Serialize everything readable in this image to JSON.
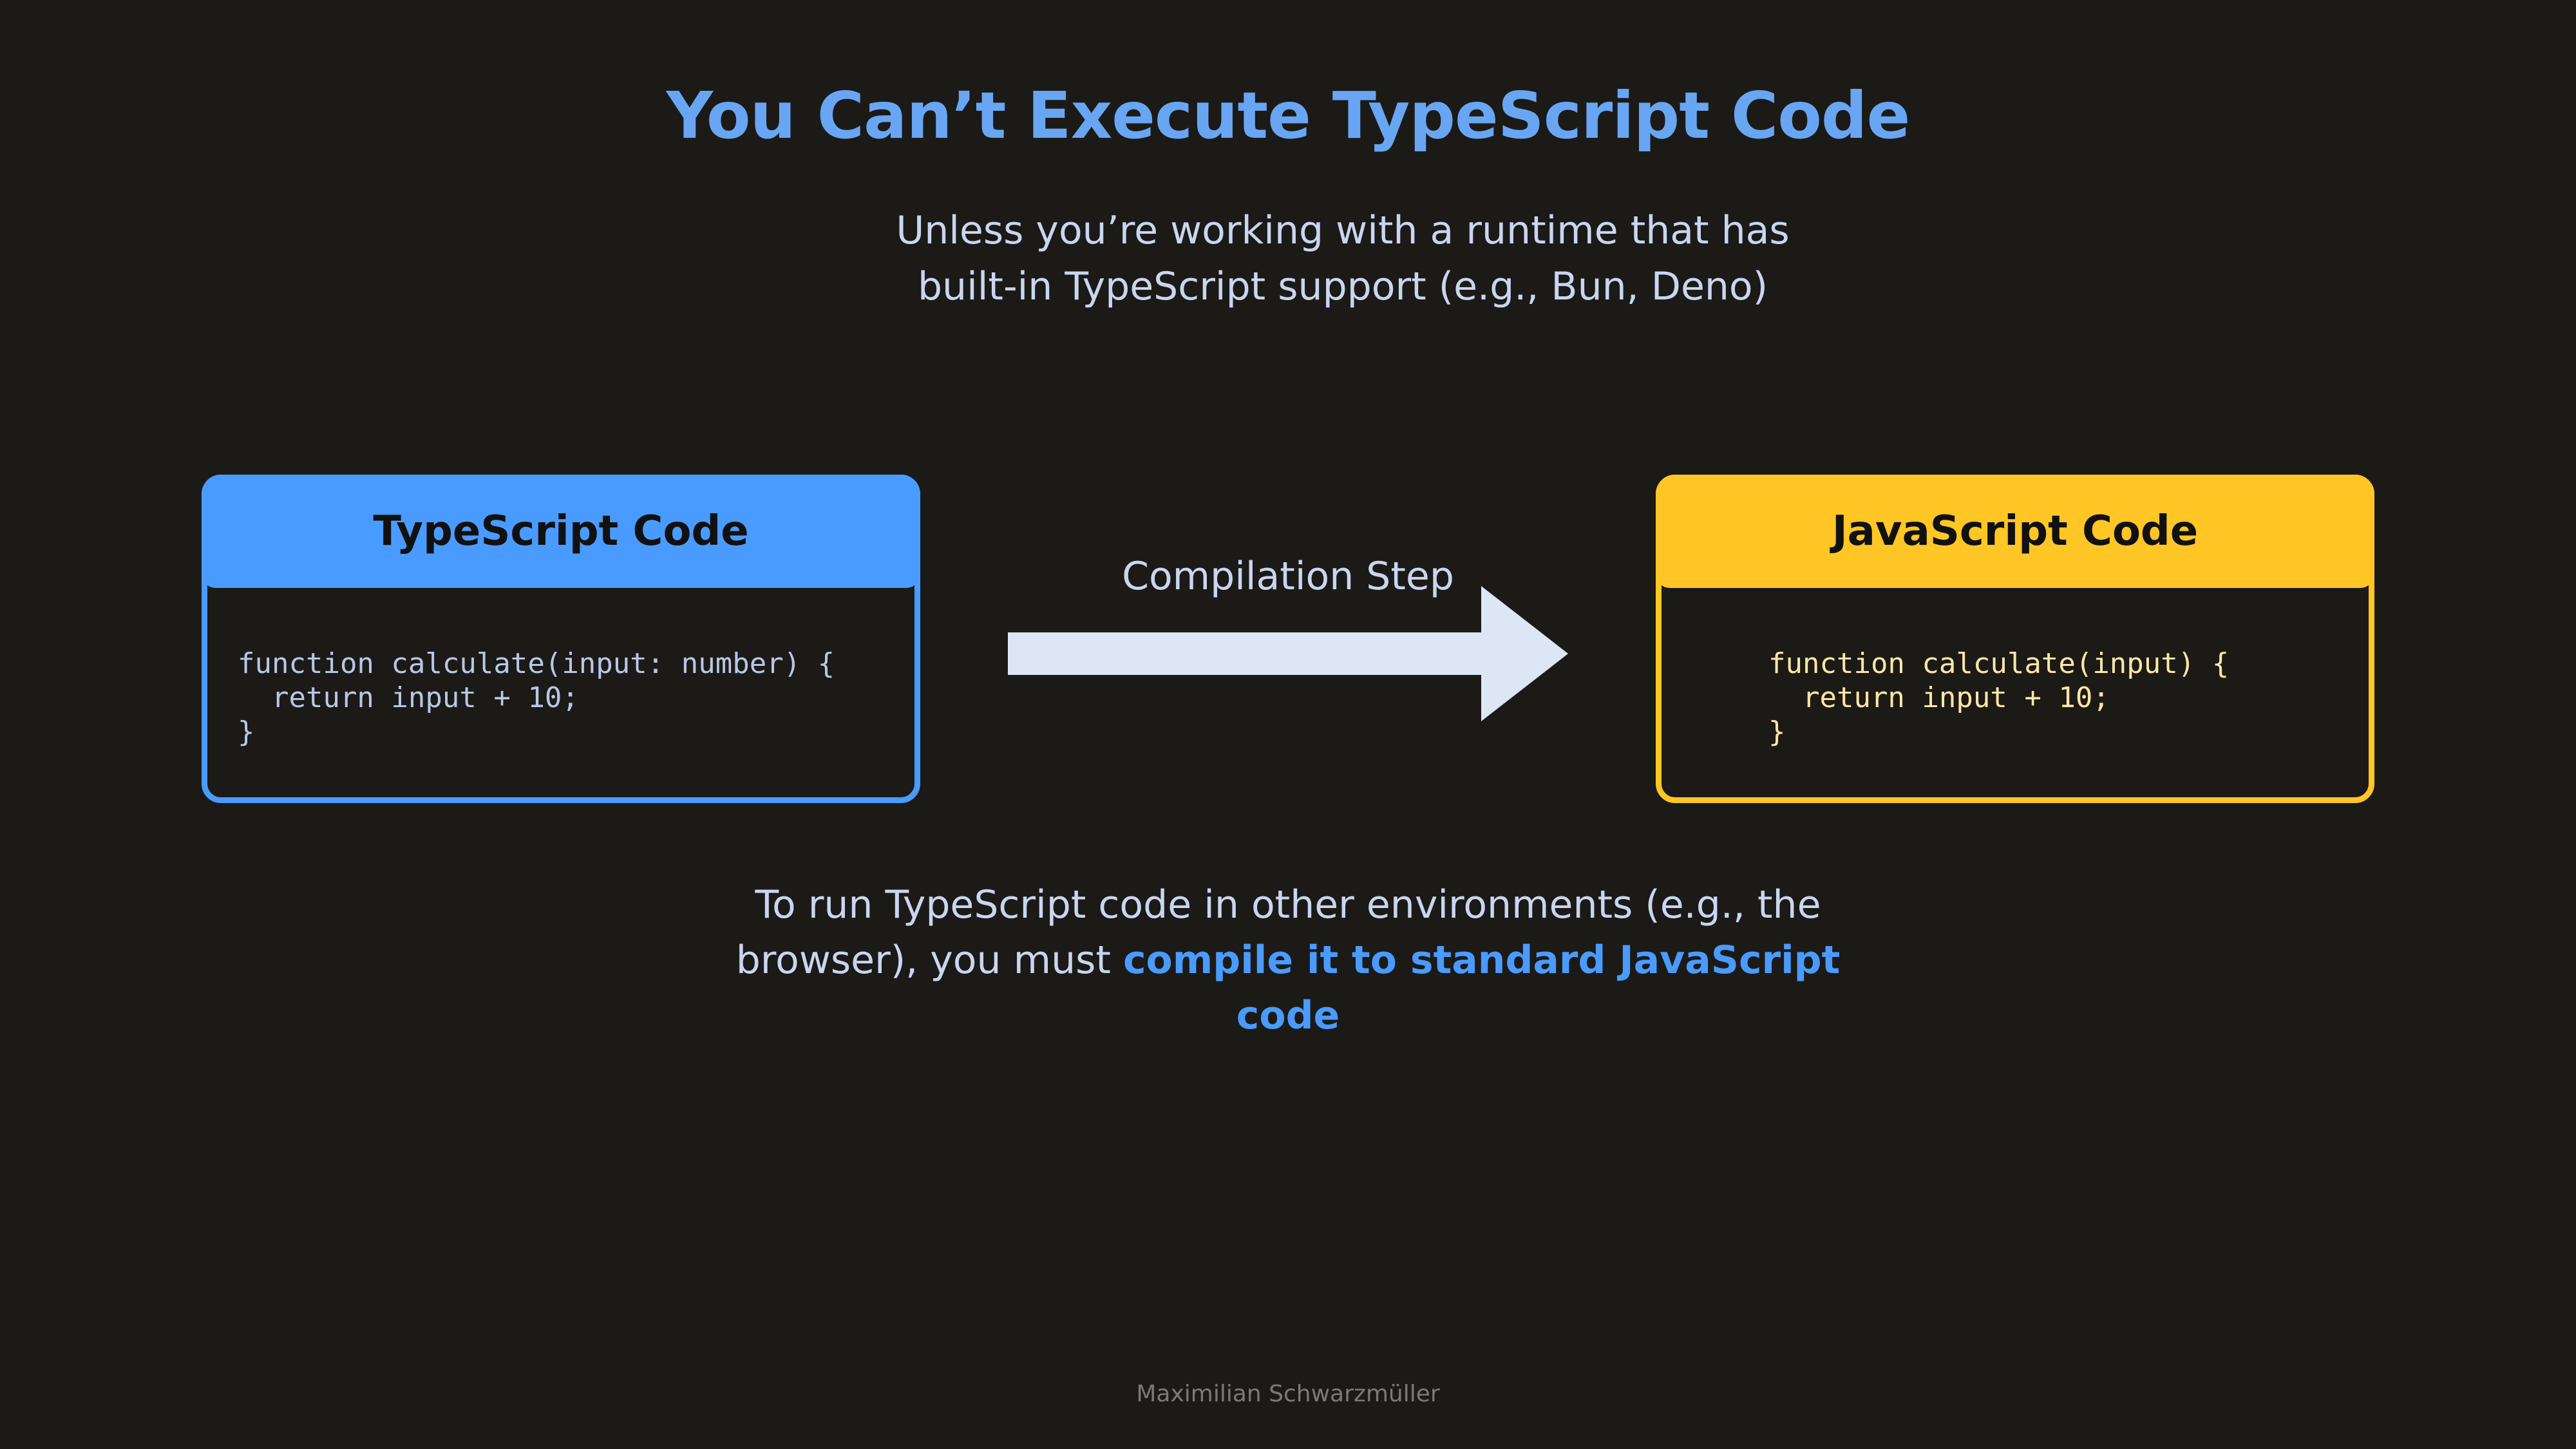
{
  "slide": {
    "title": "You Can’t Execute TypeScript Code",
    "subtitle_lines": [
      "Unless you’re working with a runtime that has",
      "built-in TypeScript support (e.g., Bun, Deno)"
    ]
  },
  "typescript_box": {
    "header": "TypeScript Code",
    "code_lines": [
      "function calculate(input: number) {",
      "  return input + 10;",
      "}"
    ],
    "accent_color": "#4a9bff"
  },
  "compilation": {
    "label": "Compilation Step",
    "arrow_color": "#dde6f4"
  },
  "javascript_box": {
    "header": "JavaScript Code",
    "code_lines": [
      "function calculate(input) {",
      "  return input + 10;",
      "}"
    ],
    "accent_color": "#ffc626"
  },
  "bottom_text": {
    "line1": "To run TypeScript code in other environments (e.g., the",
    "line2_plain": "browser), you must ",
    "line2_highlight": "compile it to standard JavaScript code"
  },
  "footer": {
    "author": "Maximilian Schwarzmüller"
  }
}
